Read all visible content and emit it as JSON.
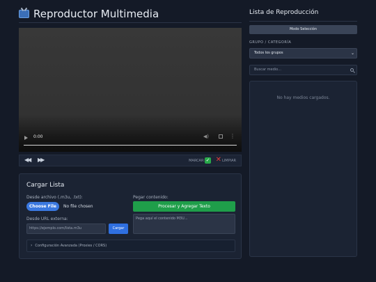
{
  "header": {
    "title": "Reproductor Multimedia",
    "icon": "tv-icon"
  },
  "player": {
    "time": "0:00",
    "progress": 0
  },
  "toolbar": {
    "prev_icon": "rewind-icon",
    "next_icon": "fast-forward-icon",
    "mark_label": "MARCAR:",
    "check_glyph": "✓",
    "x_glyph": "✕",
    "clear_label": "LIMPIAR"
  },
  "load_card": {
    "title": "Cargar Lista",
    "file_label": "Desde archivo (.m3u, .txt):",
    "file_button": "Choose File",
    "file_status": "No file chosen",
    "url_label": "Desde URL externa:",
    "url_placeholder": "https://ejemplo.com/lista.m3u",
    "load_button": "Cargar",
    "paste_label": "Pegar contenido:",
    "process_button": "Procesar y Agregar Texto",
    "paste_placeholder": "Pega aquí el contenido M3U...",
    "advanced_label": "Configuración Avanzada (Proxies / CORS)"
  },
  "sidebar": {
    "title": "Lista de Reproducción",
    "mode_button": "Modo Selección",
    "group_label": "GRUPO / CATEGORÍA",
    "group_selected": "Todos los grupos",
    "search_placeholder": "Buscar medio...",
    "empty_message": "No hay medios cargados."
  },
  "colors": {
    "background": "#141a27",
    "primary_button": "#3a78e0",
    "success_button": "#1f9e4a",
    "danger": "#e23b3b"
  }
}
